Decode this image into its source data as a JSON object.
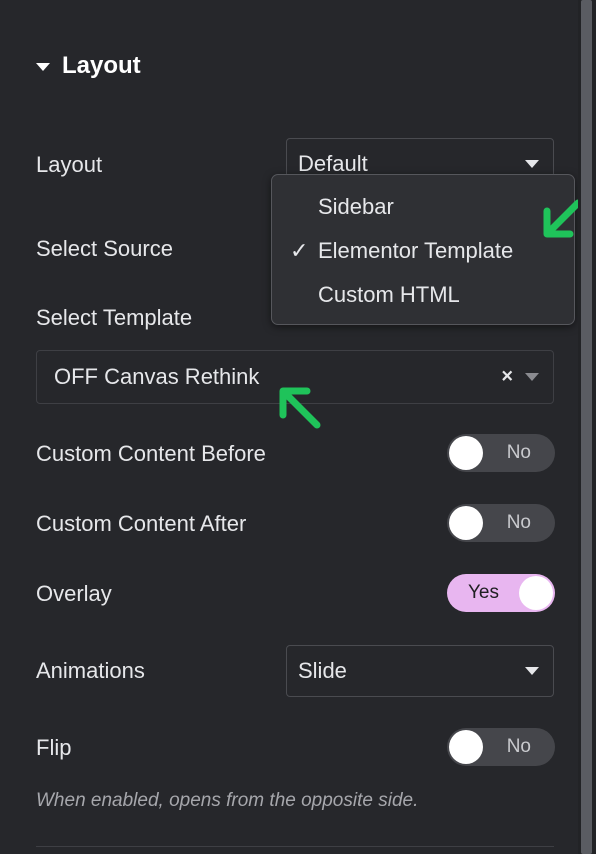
{
  "section": {
    "title": "Layout"
  },
  "fields": {
    "layout": {
      "label": "Layout",
      "value": "Default"
    },
    "select_source": {
      "label": "Select Source"
    },
    "select_template": {
      "label": "Select Template",
      "value": "OFF Canvas Rethink",
      "clear": "×"
    },
    "custom_content_before": {
      "label": "Custom Content Before",
      "toggle": "No"
    },
    "custom_content_after": {
      "label": "Custom Content After",
      "toggle": "No"
    },
    "overlay": {
      "label": "Overlay",
      "toggle": "Yes"
    },
    "animations": {
      "label": "Animations",
      "value": "Slide"
    },
    "flip": {
      "label": "Flip",
      "toggle": "No",
      "help": "When enabled, opens from the opposite side."
    }
  },
  "source_dropdown": {
    "options": [
      {
        "label": "Sidebar",
        "selected": false
      },
      {
        "label": "Elementor Template",
        "selected": true,
        "check": "✓"
      },
      {
        "label": "Custom HTML",
        "selected": false
      }
    ]
  },
  "colors": {
    "background": "#26272b",
    "toggle_on": "#e8b6f0",
    "toggle_off": "#45464b",
    "annotation_arrow": "#1fc35a"
  },
  "icons": {
    "section_toggle": "caret-down-icon",
    "dropdown": "chevron-down-icon",
    "clear": "close-icon",
    "check": "checkmark-icon",
    "annotation": "arrow-icon"
  }
}
